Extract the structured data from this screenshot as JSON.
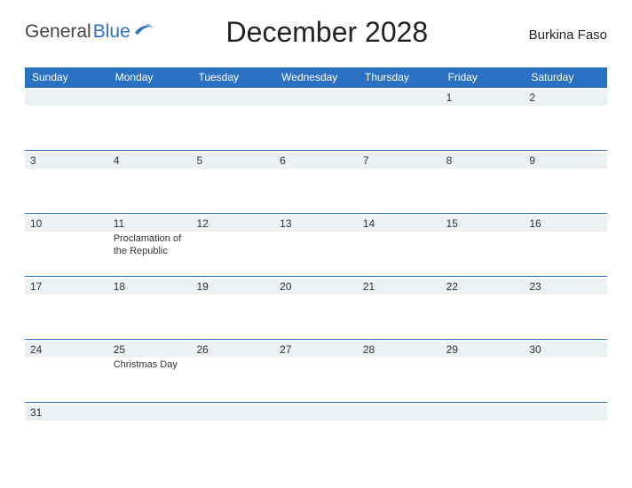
{
  "logo": {
    "word1": "General",
    "word2": "Blue"
  },
  "title": "December 2028",
  "country": "Burkina Faso",
  "dow": [
    "Sunday",
    "Monday",
    "Tuesday",
    "Wednesday",
    "Thursday",
    "Friday",
    "Saturday"
  ],
  "weeks": [
    [
      {
        "n": "",
        "e": ""
      },
      {
        "n": "",
        "e": ""
      },
      {
        "n": "",
        "e": ""
      },
      {
        "n": "",
        "e": ""
      },
      {
        "n": "",
        "e": ""
      },
      {
        "n": "1",
        "e": ""
      },
      {
        "n": "2",
        "e": ""
      }
    ],
    [
      {
        "n": "3",
        "e": ""
      },
      {
        "n": "4",
        "e": ""
      },
      {
        "n": "5",
        "e": ""
      },
      {
        "n": "6",
        "e": ""
      },
      {
        "n": "7",
        "e": ""
      },
      {
        "n": "8",
        "e": ""
      },
      {
        "n": "9",
        "e": ""
      }
    ],
    [
      {
        "n": "10",
        "e": ""
      },
      {
        "n": "11",
        "e": "Proclamation of the Republic"
      },
      {
        "n": "12",
        "e": ""
      },
      {
        "n": "13",
        "e": ""
      },
      {
        "n": "14",
        "e": ""
      },
      {
        "n": "15",
        "e": ""
      },
      {
        "n": "16",
        "e": ""
      }
    ],
    [
      {
        "n": "17",
        "e": ""
      },
      {
        "n": "18",
        "e": ""
      },
      {
        "n": "19",
        "e": ""
      },
      {
        "n": "20",
        "e": ""
      },
      {
        "n": "21",
        "e": ""
      },
      {
        "n": "22",
        "e": ""
      },
      {
        "n": "23",
        "e": ""
      }
    ],
    [
      {
        "n": "24",
        "e": ""
      },
      {
        "n": "25",
        "e": "Christmas Day"
      },
      {
        "n": "26",
        "e": ""
      },
      {
        "n": "27",
        "e": ""
      },
      {
        "n": "28",
        "e": ""
      },
      {
        "n": "29",
        "e": ""
      },
      {
        "n": "30",
        "e": ""
      }
    ],
    [
      {
        "n": "31",
        "e": ""
      },
      {
        "n": "",
        "e": ""
      },
      {
        "n": "",
        "e": ""
      },
      {
        "n": "",
        "e": ""
      },
      {
        "n": "",
        "e": ""
      },
      {
        "n": "",
        "e": ""
      },
      {
        "n": "",
        "e": ""
      }
    ]
  ]
}
